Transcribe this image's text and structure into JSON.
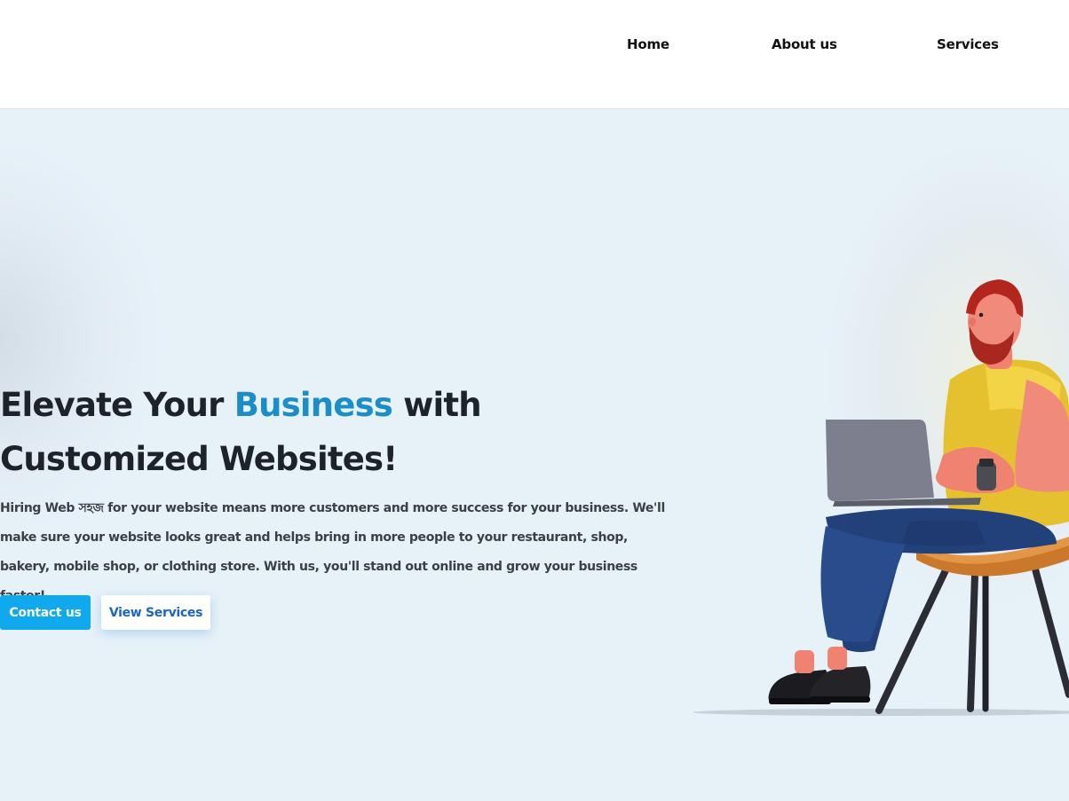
{
  "nav": {
    "items": [
      {
        "label": "Home"
      },
      {
        "label": "About us"
      },
      {
        "label": "Services"
      }
    ]
  },
  "hero": {
    "title_before": "Elevate Your ",
    "title_accent": "Business",
    "title_after": " with Customized Websites!",
    "description": "Hiring Web সহজ for your website means more customers and more success for your business. We'll make sure your website looks great and helps bring in more people to your restaurant, shop, bakery, mobile shop, or clothing store. With us, you'll stand out online and grow your business faster!",
    "primary_button": "Contact us",
    "secondary_button": "View Services"
  },
  "colors": {
    "accent": "#1b8dc9",
    "primary_button": "#10a9ee",
    "background": "#e7f1f8"
  },
  "illustration": {
    "icon": "person-with-laptop-illustration"
  }
}
